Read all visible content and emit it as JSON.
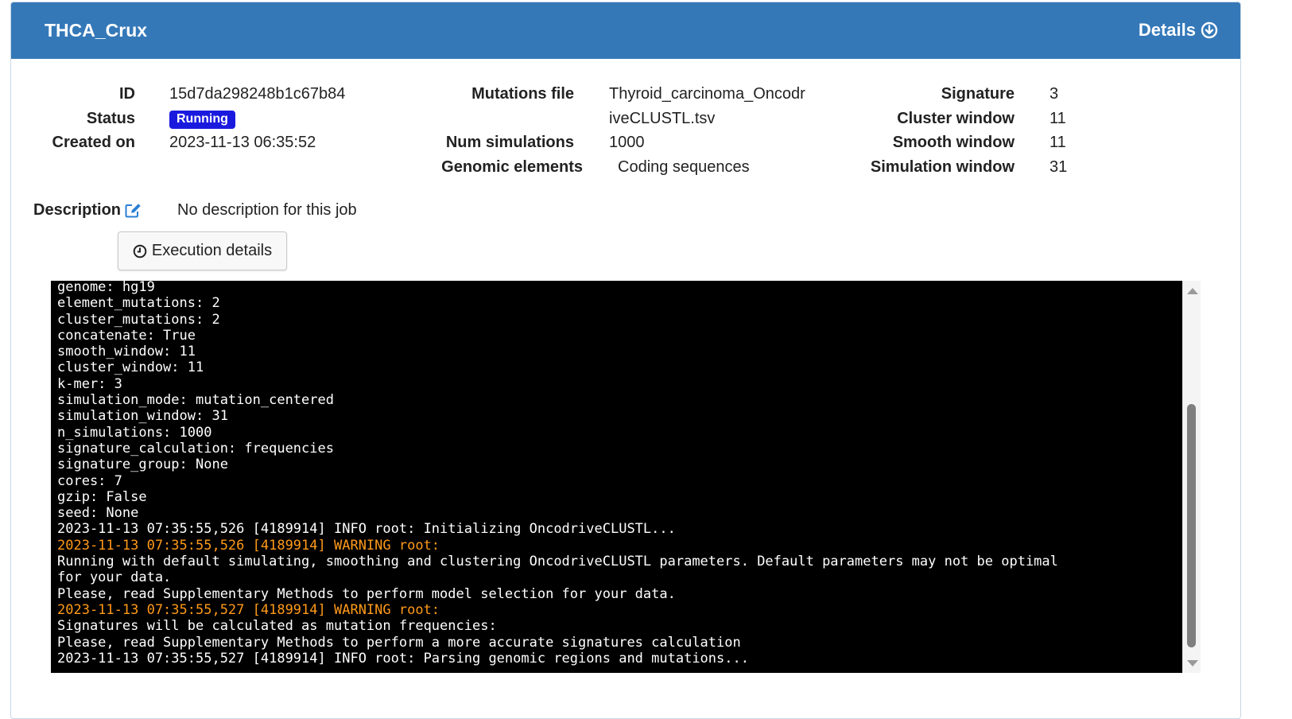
{
  "header": {
    "job_title": "THCA_Crux",
    "details_label": "Details"
  },
  "info": {
    "id_label": "ID",
    "id_value": "15d7da298248b1c67b84",
    "status_label": "Status",
    "status_value": "Running",
    "created_label": "Created on",
    "created_value": "2023-11-13 06:35:52",
    "mutations_label": "Mutations file",
    "mutations_value_line1": "Thyroid_carcinoma_Oncodr",
    "mutations_value_line2": "iveCLUSTL.tsv",
    "num_sim_label": "Num simulations",
    "num_sim_value": "1000",
    "genomic_label": "Genomic elements",
    "genomic_value": "Coding sequences",
    "signature_label": "Signature",
    "signature_value": "3",
    "cluster_label": "Cluster window",
    "cluster_value": "11",
    "smooth_label": "Smooth window",
    "smooth_value": "11",
    "simwin_label": "Simulation window",
    "simwin_value": "31",
    "status_color": "#1a1adf"
  },
  "description": {
    "label": "Description",
    "value": "No description for this job"
  },
  "execution": {
    "button_label": "Execution details"
  },
  "console": {
    "lines": [
      {
        "text": "genome: hg19",
        "level": "info"
      },
      {
        "text": "element_mutations: 2",
        "level": "info"
      },
      {
        "text": "cluster_mutations: 2",
        "level": "info"
      },
      {
        "text": "concatenate: True",
        "level": "info"
      },
      {
        "text": "smooth_window: 11",
        "level": "info"
      },
      {
        "text": "cluster_window: 11",
        "level": "info"
      },
      {
        "text": "k-mer: 3",
        "level": "info"
      },
      {
        "text": "simulation_mode: mutation_centered",
        "level": "info"
      },
      {
        "text": "simulation_window: 31",
        "level": "info"
      },
      {
        "text": "n_simulations: 1000",
        "level": "info"
      },
      {
        "text": "signature_calculation: frequencies",
        "level": "info"
      },
      {
        "text": "signature_group: None",
        "level": "info"
      },
      {
        "text": "cores: 7",
        "level": "info"
      },
      {
        "text": "gzip: False",
        "level": "info"
      },
      {
        "text": "seed: None",
        "level": "info"
      },
      {
        "text": "2023-11-13 07:35:55,526 [4189914] INFO root: Initializing OncodriveCLUSTL...",
        "level": "info"
      },
      {
        "text": "2023-11-13 07:35:55,526 [4189914] WARNING root:",
        "level": "warning"
      },
      {
        "text": "Running with default simulating, smoothing and clustering OncodriveCLUSTL parameters. Default parameters may not be optimal",
        "level": "info"
      },
      {
        "text": "for your data.",
        "level": "info"
      },
      {
        "text": "Please, read Supplementary Methods to perform model selection for your data.",
        "level": "info"
      },
      {
        "text": "2023-11-13 07:35:55,527 [4189914] WARNING root:",
        "level": "warning"
      },
      {
        "text": "Signatures will be calculated as mutation frequencies:",
        "level": "info"
      },
      {
        "text": "Please, read Supplementary Methods to perform a more accurate signatures calculation",
        "level": "info"
      },
      {
        "text": "2023-11-13 07:35:55,527 [4189914] INFO root: Parsing genomic regions and mutations...",
        "level": "info"
      }
    ],
    "warning_color": "#ff9a1a"
  }
}
